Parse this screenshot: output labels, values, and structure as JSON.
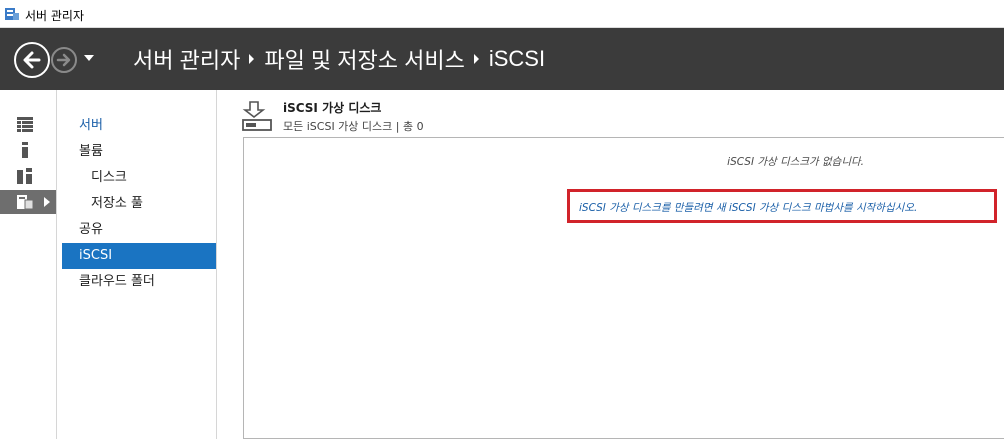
{
  "window": {
    "title": "서버 관리자"
  },
  "breadcrumb": {
    "part1": "서버 관리자",
    "part2": "파일 및 저장소 서비스",
    "part3": "iSCSI"
  },
  "iconbar": {
    "icons": [
      "dashboard-icon",
      "local-server-icon",
      "all-servers-icon",
      "file-storage-icon"
    ]
  },
  "nav": {
    "items": [
      {
        "label": "서버"
      },
      {
        "label": "볼륨"
      },
      {
        "label": "디스크"
      },
      {
        "label": "저장소 풀"
      },
      {
        "label": "공유"
      },
      {
        "label": "iSCSI"
      },
      {
        "label": "클라우드 폴더"
      }
    ]
  },
  "content": {
    "title": "iSCSI 가상 디스크",
    "subtitle": "모든 iSCSI 가상 디스크 | 총 0",
    "empty_message": "iSCSI 가상 디스크가 없습니다.",
    "wizard_link": "iSCSI 가상 디스크를 만들려면 새 iSCSI 가상 디스크 마법사를 시작하십시오."
  },
  "colors": {
    "header_bg": "#3b3b3b",
    "selected_nav": "#1a74c2",
    "link": "#1a5fa8",
    "highlight": "#d1232a"
  }
}
